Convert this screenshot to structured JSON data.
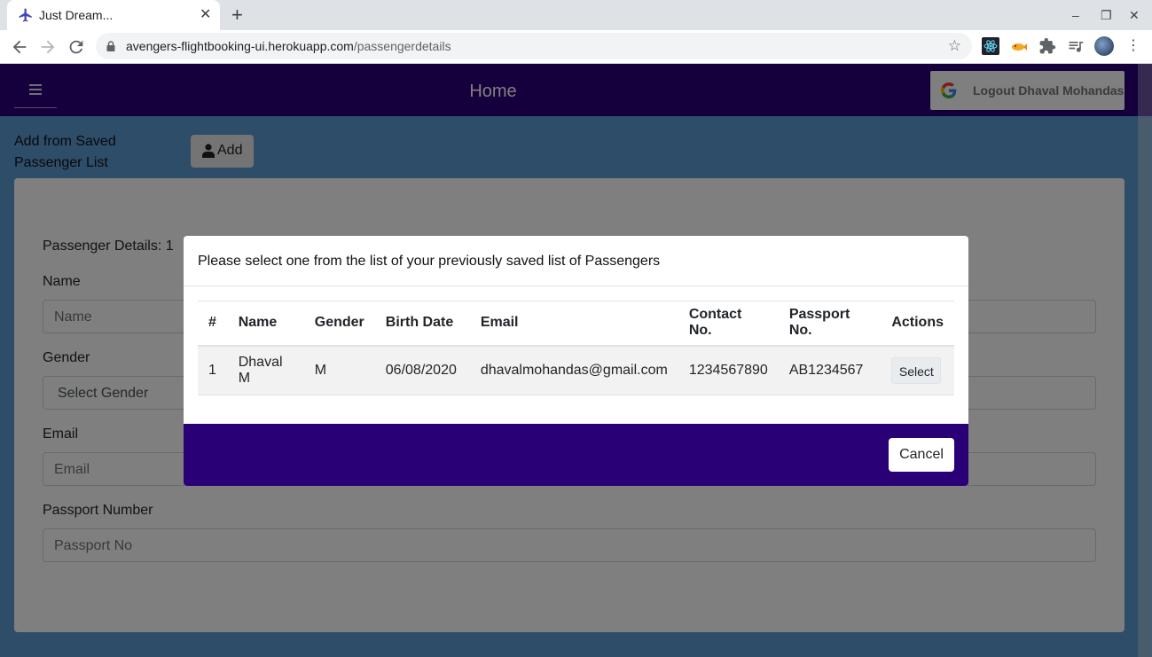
{
  "browser": {
    "tab_title": "Just Dream...",
    "tab_close": "✕",
    "new_tab": "+",
    "url_host": "avengers-flightbooking-ui.herokuapp.com",
    "url_path": "/passengerdetails",
    "window_controls": {
      "minimize": "–",
      "restore": "❐",
      "close": "✕"
    }
  },
  "navbar": {
    "title": "Home",
    "logout_label": "Logout Dhaval Mohandas",
    "colors": {
      "background": "#2a007a"
    }
  },
  "saved": {
    "label": "Add from Saved Passenger List",
    "add_label": "Add"
  },
  "form": {
    "heading": "Passenger Details: 1",
    "name_label": "Name",
    "name_placeholder": "Name",
    "gender_label": "Gender",
    "gender_value": "Select Gender",
    "email_label": "Email",
    "email_placeholder": "Email",
    "passport_label": "Passport Number",
    "passport_placeholder": "Passport No"
  },
  "modal": {
    "title": "Please select one from the list of your previously saved list of Passengers",
    "columns": [
      "#",
      "Name",
      "Gender",
      "Birth Date",
      "Email",
      "Contact No.",
      "Passport No.",
      "Actions"
    ],
    "rows": [
      {
        "index": "1",
        "name": "Dhaval M",
        "gender": "M",
        "birth_date": "06/08/2020",
        "email": "dhavalmohandas@gmail.com",
        "contact": "1234567890",
        "passport": "AB1234567",
        "action_label": "Select"
      }
    ],
    "cancel_label": "Cancel",
    "colors": {
      "footer": "#2a0077"
    }
  }
}
